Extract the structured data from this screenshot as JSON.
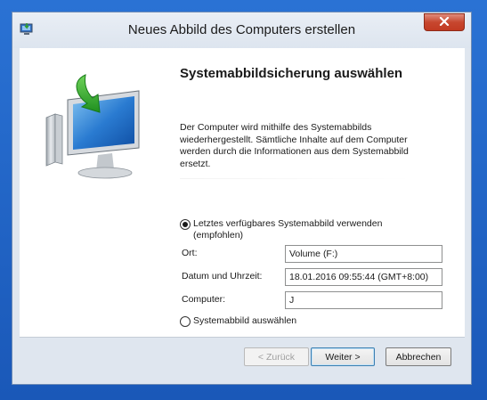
{
  "window": {
    "title": "Neues Abbild des Computers erstellen"
  },
  "page": {
    "heading": "Systemabbildsicherung auswählen",
    "description": "Der Computer wird mithilfe des Systemabbilds wiederhergestellt. Sämtliche Inhalte auf dem Computer werden durch die Informationen aus dem Systemabbild ersetzt."
  },
  "options": {
    "latest": {
      "label": "Letztes verfügbares Systemabbild verwenden (empfohlen)",
      "selected": true
    },
    "choose": {
      "label": "Systemabbild auswählen",
      "selected": false
    }
  },
  "fields": {
    "location": {
      "label": "Ort:",
      "value": "Volume (F:)"
    },
    "datetime": {
      "label": "Datum und Uhrzeit:",
      "value": "18.01.2016  09:55:44 (GMT+8:00)"
    },
    "computer": {
      "label": "Computer:",
      "value": "J"
    }
  },
  "buttons": {
    "back": "< Zurück",
    "next": "Weiter >",
    "cancel": "Abbrechen"
  },
  "colors": {
    "desktop": "#1c5fc2",
    "close_button": "#c7472f",
    "window_frame": "#dfe6ef"
  },
  "icons": {
    "app": "system-restore-icon",
    "close": "close-icon",
    "illustration": "computer-restore-icon"
  }
}
